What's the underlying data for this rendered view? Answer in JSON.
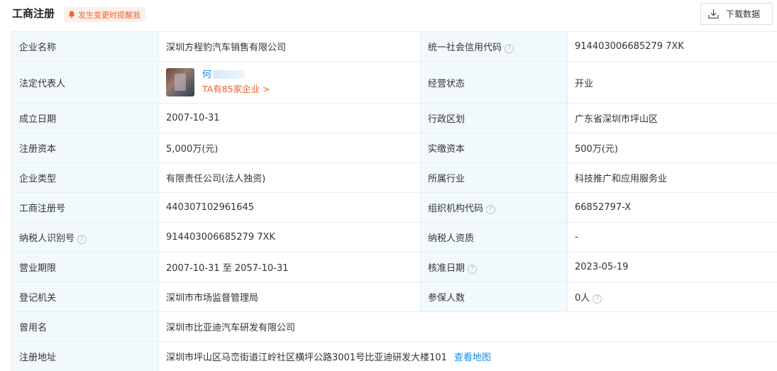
{
  "header": {
    "title": "工商注册",
    "remind_label": "发生变更时提醒我",
    "download_label": "下载数据"
  },
  "rows": {
    "company_name": {
      "label": "企业名称",
      "value": "深圳方程豹汽车销售有限公司"
    },
    "credit_code": {
      "label": "统一社会信用代码",
      "value": "914403006685279 7XK"
    },
    "legal_rep": {
      "label": "法定代表人",
      "name": "何",
      "link": "TA有85家企业 >"
    },
    "status": {
      "label": "经营状态",
      "value": "开业"
    },
    "founded": {
      "label": "成立日期",
      "value": "2007-10-31"
    },
    "region": {
      "label": "行政区划",
      "value": "广东省深圳市坪山区"
    },
    "reg_capital": {
      "label": "注册资本",
      "value": "5,000万(元)"
    },
    "paid_capital": {
      "label": "实缴资本",
      "value": "500万(元)"
    },
    "company_type": {
      "label": "企业类型",
      "value": "有限责任公司(法人独资)"
    },
    "industry": {
      "label": "所属行业",
      "value": "科技推广和应用服务业"
    },
    "reg_no": {
      "label": "工商注册号",
      "value": "440307102961645"
    },
    "org_code": {
      "label": "组织机构代码",
      "value": "66852797-X"
    },
    "taxpayer_id": {
      "label": "纳税人识别号",
      "value": "914403006685279 7XK"
    },
    "taxpayer_qual": {
      "label": "纳税人资质",
      "value": "-"
    },
    "term": {
      "label": "营业期限",
      "value": "2007-10-31 至 2057-10-31"
    },
    "approve_date": {
      "label": "核准日期",
      "value": "2023-05-19"
    },
    "authority": {
      "label": "登记机关",
      "value": "深圳市市场监督管理局"
    },
    "insured": {
      "label": "参保人数",
      "value": "0人"
    },
    "former_name": {
      "label": "曾用名",
      "value": "深圳市比亚迪汽车研发有限公司"
    },
    "address": {
      "label": "注册地址",
      "value": "深圳市坪山区马峦街道江岭社区横坪公路3001号比亚迪研发大楼101",
      "map_link": "查看地图"
    }
  },
  "icons": {
    "help": "?"
  },
  "colors": {
    "accent_blue": "#128bed",
    "accent_orange": "#f0642c",
    "label_bg": "#f2f9fc",
    "border": "#e4eef6"
  }
}
